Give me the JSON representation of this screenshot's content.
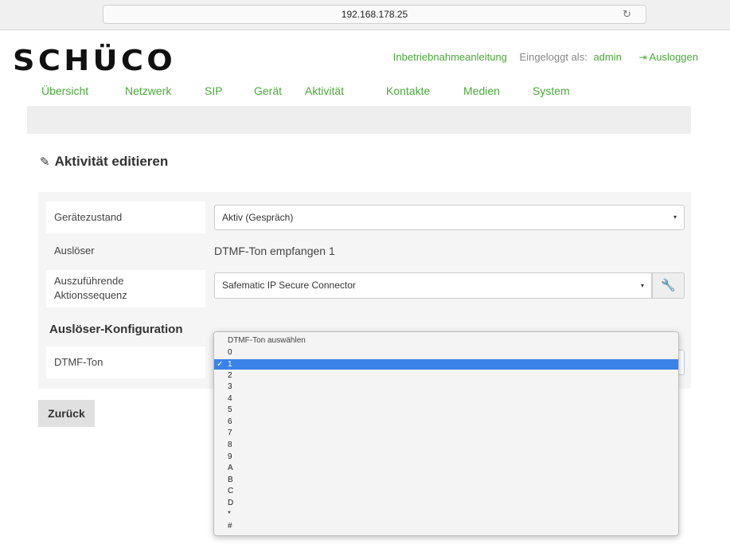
{
  "browser": {
    "url": "192.168.178.25",
    "reload_icon": "reload-icon"
  },
  "header": {
    "logo_text": "SCHÜCO",
    "manual_link": "Inbetriebnahmeanleitung",
    "logged_in_label": "Eingeloggt als:",
    "user": "admin",
    "logout_label": "Ausloggen",
    "logout_icon": "sign-out-icon"
  },
  "nav": {
    "items": [
      "Übersicht",
      "Netzwerk",
      "SIP",
      "Gerät",
      "Aktivität",
      "Kontakte",
      "Medien",
      "System"
    ]
  },
  "page": {
    "title": "Aktivität editieren",
    "title_icon": "pencil-icon"
  },
  "form": {
    "device_state_label": "Gerätezustand",
    "device_state_value": "Aktiv (Gespräch)",
    "trigger_label": "Auslöser",
    "trigger_value": "DTMF-Ton empfangen 1",
    "action_seq_label_1": "Auszuführende",
    "action_seq_label_2": "Aktionssequenz",
    "action_seq_value": "Safematic IP Secure Connector",
    "action_seq_tool_icon": "wrench-icon",
    "trigger_config_heading": "Auslöser-Konfiguration",
    "dtmf_label": "DTMF-Ton"
  },
  "buttons": {
    "back": "Zurück"
  },
  "dropdown": {
    "placeholder": "DTMF-Ton auswählen",
    "options": [
      "0",
      "1",
      "2",
      "3",
      "4",
      "5",
      "6",
      "7",
      "8",
      "9",
      "A",
      "B",
      "C",
      "D",
      "*",
      "#"
    ],
    "selected": "1"
  },
  "colors": {
    "brand_green": "#4aaa3a",
    "selection_blue": "#3b82e8"
  }
}
